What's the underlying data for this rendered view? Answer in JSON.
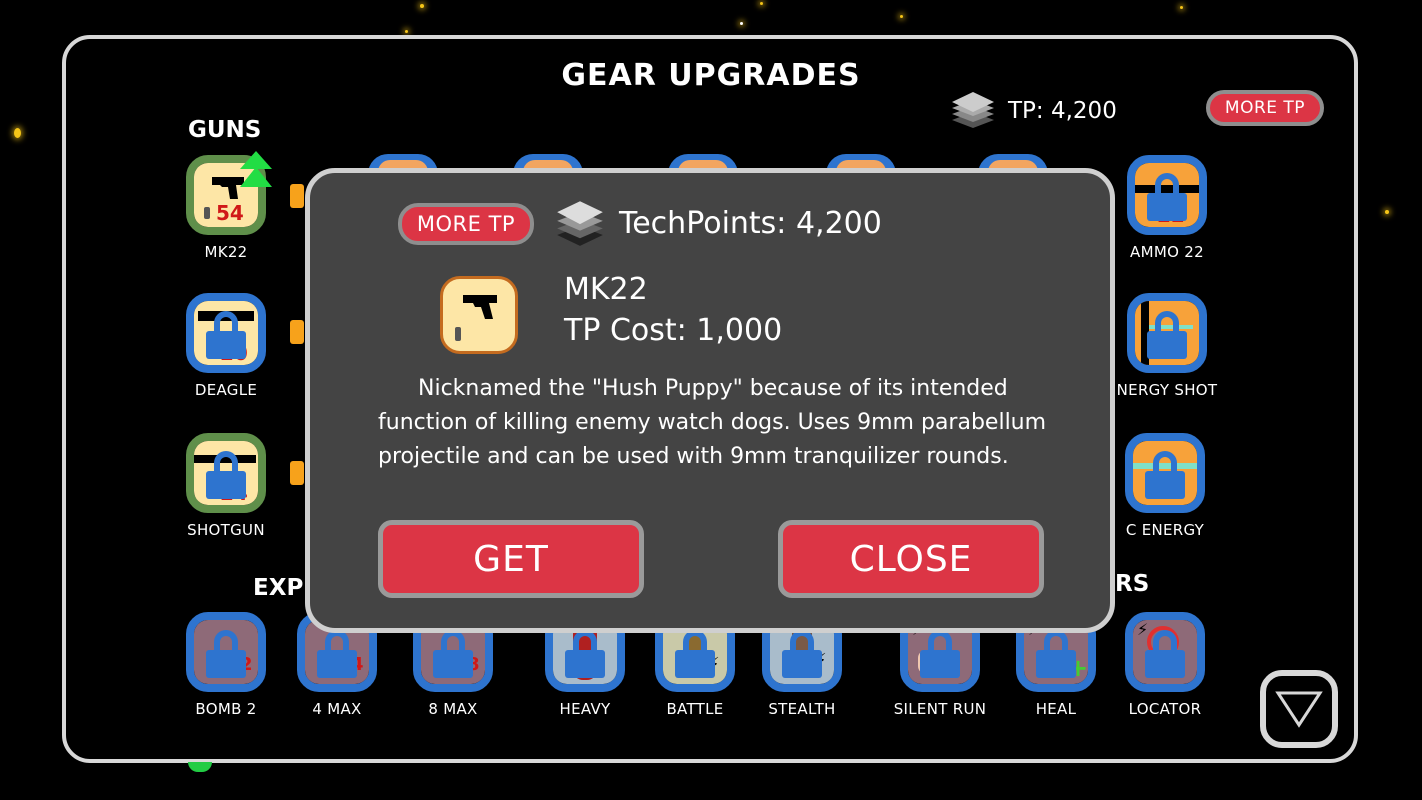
{
  "header": {
    "title": "GEAR UPGRADES",
    "tp_label": "TP: 4,200",
    "more_tp": "MORE TP",
    "tp_icon": "techpoints-stack-icon"
  },
  "sections": {
    "guns": "GUNS",
    "explosives_partial": "EXP",
    "right_partial": "RS"
  },
  "guns": [
    {
      "label": "MK22",
      "ammo": "54",
      "state": "owned",
      "upgrade": true
    },
    {
      "label": "DEAGLE",
      "ammo": "20",
      "state": "locked"
    },
    {
      "label": "SHOTGUN",
      "ammo": "24",
      "state": "locked"
    }
  ],
  "right_column": [
    {
      "label": "AMMO 22",
      "ammo": "22",
      "state": "locked"
    },
    {
      "label": "NERGY SHOT",
      "state": "locked"
    },
    {
      "label": "C ENERGY",
      "state": "locked"
    }
  ],
  "bottom_row": [
    {
      "label": "BOMB 2",
      "num": "2",
      "state": "locked"
    },
    {
      "label": "4 MAX",
      "num": "4",
      "state": "locked"
    },
    {
      "label": "8 MAX",
      "num": "8",
      "state": "locked"
    },
    {
      "label": "HEAVY",
      "state": "locked"
    },
    {
      "label": "BATTLE",
      "state": "locked"
    },
    {
      "label": "STEALTH",
      "state": "locked"
    },
    {
      "label": "SILENT RUN",
      "state": "locked"
    },
    {
      "label": "HEAL",
      "state": "locked"
    },
    {
      "label": "LOCATOR",
      "state": "locked"
    }
  ],
  "modal": {
    "more_tp": "MORE TP",
    "techpoints": "TechPoints: 4,200",
    "item_name": "MK22",
    "cost": "TP Cost: 1,000",
    "description": "Nicknamed the \"Hush Puppy\" because of its intended function of killing enemy watch dogs. Uses 9mm parabellum projectile and can be used with 9mm tranquilizer rounds.",
    "get": "GET",
    "close": "CLOSE"
  },
  "colors": {
    "accent_red": "#dc3545",
    "lock_blue": "#2e74cf",
    "owned_green": "#5f8f4a",
    "modal_bg": "#444444"
  }
}
